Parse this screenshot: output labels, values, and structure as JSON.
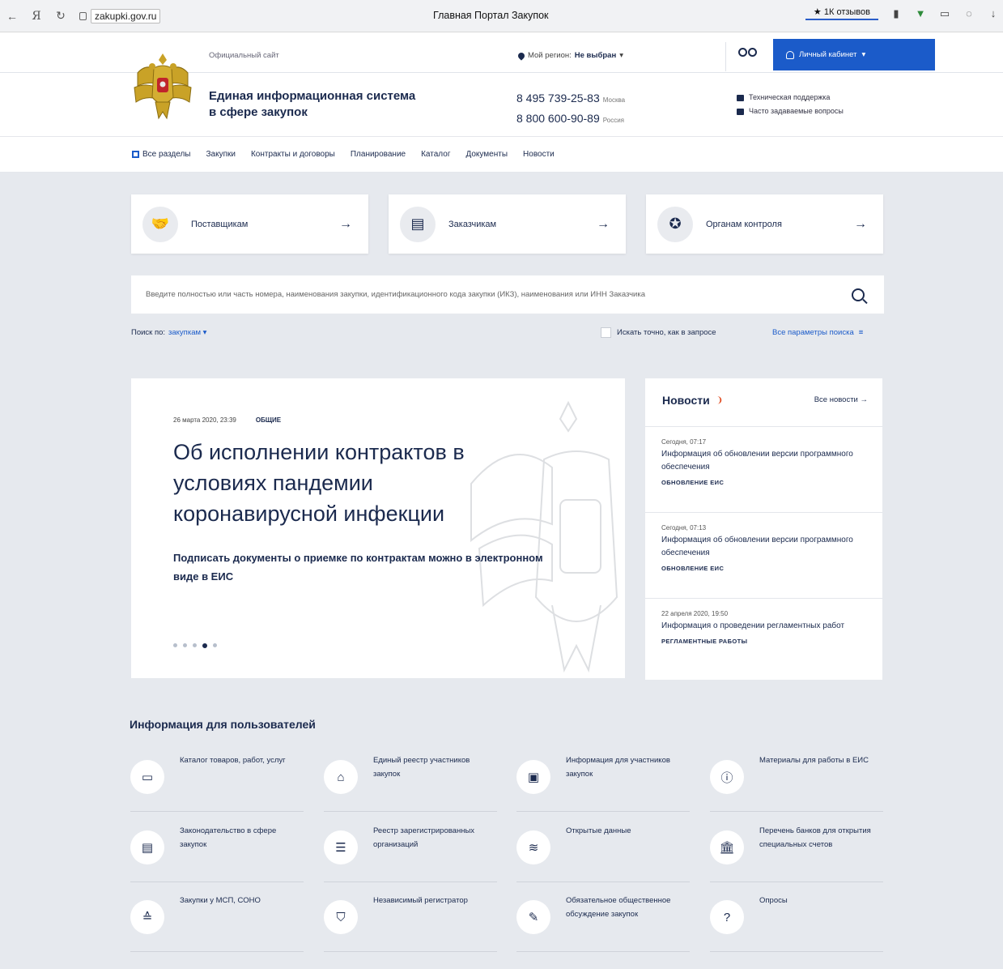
{
  "browser": {
    "url": "zakupki.gov.ru",
    "title": "Главная Портал Закупок",
    "reviews": "1К отзывов"
  },
  "header": {
    "official": "Официальный сайт",
    "region_label": "Мой регион:",
    "region_value": "Не выбран",
    "cabinet": "Личный кабинет",
    "system_name_1": "Единая информационная система",
    "system_name_2": "в сфере закупок",
    "phone_moscow": "8 495 739-25-83",
    "phone_moscow_label": "Москва",
    "phone_russia": "8 800 600-90-89",
    "phone_russia_label": "Россия",
    "support": "Техническая поддержка",
    "faq": "Часто задаваемые вопросы"
  },
  "nav": [
    "Все разделы",
    "Закупки",
    "Контракты и договоры",
    "Планирование",
    "Каталог",
    "Документы",
    "Новости"
  ],
  "roles": [
    "Поставщикам",
    "Заказчикам",
    "Органам контроля"
  ],
  "search": {
    "placeholder": "Введите полностью или часть номера, наименования закупки, идентификационного кода закупки (ИКЗ), наименования или ИНН Заказчика",
    "by_label": "Поиск по:",
    "by_value": "закупкам",
    "exact": "Искать точно, как в запросе",
    "all_params": "Все параметры поиска"
  },
  "slide": {
    "date": "26 марта 2020, 23:39",
    "tag": "ОБЩИЕ",
    "headline": "Об исполнении контрактов в условиях пандемии коронавирусной инфекции",
    "lead": "Подписать документы о приемке по контрактам можно в электронном виде в ЕИС",
    "active_dot": 4,
    "dot_count": 5
  },
  "news": {
    "title": "Новости",
    "all": "Все новости",
    "items": [
      {
        "date": "Сегодня, 07:17",
        "text": "Информация об обновлении версии программного обеспечения",
        "category": "ОБНОВЛЕНИЕ ЕИС"
      },
      {
        "date": "Сегодня, 07:13",
        "text": "Информация об обновлении версии программного обеспечения",
        "category": "ОБНОВЛЕНИЕ ЕИС"
      },
      {
        "date": "22 апреля 2020, 19:50",
        "text": "Информация о проведении регламентных работ",
        "category": "РЕГЛАМЕНТНЫЕ РАБОТЫ"
      }
    ]
  },
  "info": {
    "title": "Информация для пользователей",
    "tiles": [
      {
        "label": "Каталог товаров, работ, услуг",
        "icon": "folder-icon"
      },
      {
        "label": "Единый реестр участников закупок",
        "icon": "registry-icon"
      },
      {
        "label": "Информация для участников закупок",
        "icon": "briefcase-icon"
      },
      {
        "label": "Материалы для работы в ЕИС",
        "icon": "info-doc-icon"
      },
      {
        "label": "Законодательство в сфере закупок",
        "icon": "document-icon"
      },
      {
        "label": "Реестр зарегистрированных организаций",
        "icon": "list-doc-icon"
      },
      {
        "label": "Открытые данные",
        "icon": "database-icon"
      },
      {
        "label": "Перечень банков для открытия специальных счетов",
        "icon": "bank-icon"
      },
      {
        "label": "Закупки у МСП, СОНО",
        "icon": "stack-icon"
      },
      {
        "label": "Независимый регистратор",
        "icon": "shield-icon"
      },
      {
        "label": "Обязательное общественное обсуждение закупок",
        "icon": "edit-doc-icon"
      },
      {
        "label": "Опросы",
        "icon": "question-icon"
      }
    ]
  }
}
